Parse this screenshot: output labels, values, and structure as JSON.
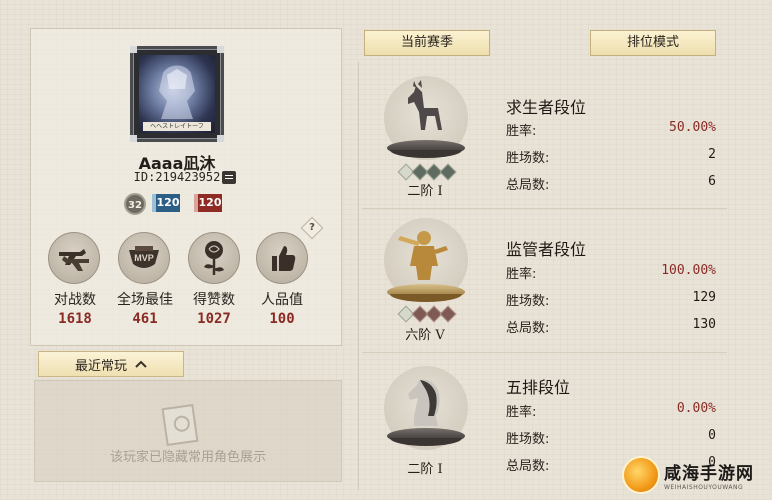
{
  "profile": {
    "avatar_caption": "ヘヘストレイトーフ",
    "name": "Aaaa凪沐",
    "id_text": "ID:219423952",
    "level": "32",
    "rank_blue": "120",
    "rank_red": "120",
    "help_glyph": "?",
    "stats": [
      {
        "label": "对战数",
        "value": "1618",
        "icon": "crossed-pistols-icon"
      },
      {
        "label": "全场最佳",
        "value": "461",
        "icon": "mvp-icon"
      },
      {
        "label": "得赞数",
        "value": "1027",
        "icon": "rose-icon"
      },
      {
        "label": "人品值",
        "value": "100",
        "icon": "thumbs-up-icon"
      }
    ]
  },
  "recent": {
    "tab_label": "最近常玩",
    "hidden_text": "该玩家已隐藏常用角色展示"
  },
  "tabs": {
    "current_season": "当前赛季",
    "rank_mode": "排位模式"
  },
  "sections": [
    {
      "title": "求生者段位",
      "tier": "二阶 I",
      "stars_filled": 0,
      "rows": [
        {
          "label": "胜率:",
          "value": "50.00%"
        },
        {
          "label": "胜场数:",
          "value": "2"
        },
        {
          "label": "总局数:",
          "value": "6"
        }
      ]
    },
    {
      "title": "监管者段位",
      "tier": "六阶 V",
      "stars_filled": 4,
      "rows": [
        {
          "label": "胜率:",
          "value": "100.00%"
        },
        {
          "label": "胜场数:",
          "value": "129"
        },
        {
          "label": "总局数:",
          "value": "130"
        }
      ]
    },
    {
      "title": "五排段位",
      "tier": "二阶 I",
      "stars_filled": 0,
      "rows": [
        {
          "label": "胜率:",
          "value": "0.00%"
        },
        {
          "label": "胜场数:",
          "value": "0"
        },
        {
          "label": "总局数:",
          "value": "0"
        }
      ]
    }
  ],
  "watermark": {
    "cn": "咸海手游网",
    "en": "WEIHAISHOUYOUWANG"
  },
  "colors": {
    "accent_red": "#8a2a24",
    "tab_gold": "#eedfae",
    "background": "#e9e2d6"
  }
}
